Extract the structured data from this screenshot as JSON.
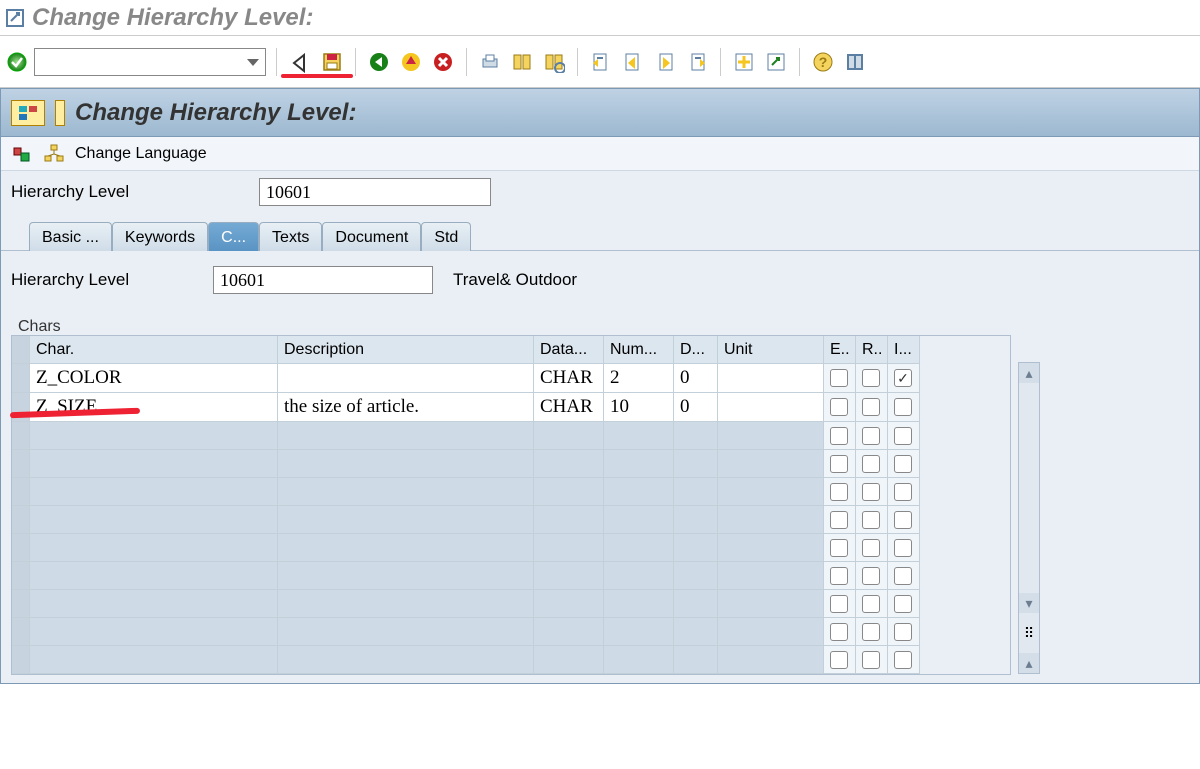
{
  "window": {
    "title": "Change Hierarchy Level:"
  },
  "header": {
    "title": "Change Hierarchy Level:"
  },
  "sub_toolbar": {
    "change_language": "Change Language"
  },
  "form": {
    "label": "Hierarchy Level",
    "value": "10601",
    "label2": "Hierarchy Level",
    "value2": "10601",
    "desc2": "Travel& Outdoor"
  },
  "tabs": [
    "Basic ...",
    "Keywords",
    "C...",
    "Texts",
    "Document",
    "Std"
  ],
  "active_tab_index": 2,
  "table": {
    "caption": "Chars",
    "headers": [
      "Char.",
      "Description",
      "Data...",
      "Num...",
      "D...",
      "Unit",
      "E..",
      "R..",
      "I..."
    ],
    "rows": [
      {
        "char": "Z_COLOR",
        "desc": "",
        "data": "CHAR",
        "num": "2",
        "d": "0",
        "unit": "",
        "e": false,
        "r": false,
        "i": true
      },
      {
        "char": "Z_SIZE",
        "desc": "the size of article.",
        "data": "CHAR",
        "num": "10",
        "d": "0",
        "unit": "",
        "e": false,
        "r": false,
        "i": false
      }
    ],
    "empty_rows": 9
  }
}
